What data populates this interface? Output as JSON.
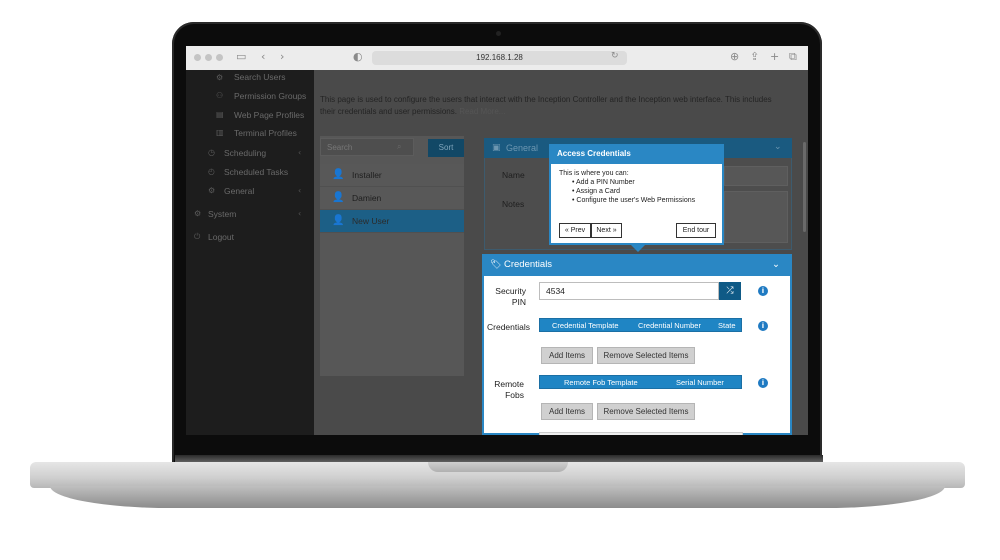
{
  "browser": {
    "url": "192.168.1.28"
  },
  "sidebar": {
    "items": [
      {
        "label": "Search Users",
        "icon": "gear-icon",
        "indent": true
      },
      {
        "label": "Permission Groups",
        "icon": "people-icon",
        "indent": true
      },
      {
        "label": "Web Page Profiles",
        "icon": "page-icon",
        "indent": true
      },
      {
        "label": "Terminal Profiles",
        "icon": "terminal-icon",
        "indent": true
      },
      {
        "label": "Scheduling",
        "icon": "calendar-icon",
        "indent": false,
        "has_arrow": true
      },
      {
        "label": "Scheduled Tasks",
        "icon": "clock-icon",
        "indent": false
      },
      {
        "label": "General",
        "icon": "settings-icon",
        "indent": false,
        "has_arrow": true
      },
      {
        "label": "System",
        "icon": "gear-icon",
        "indent": false,
        "has_arrow": true
      },
      {
        "label": "Logout",
        "icon": "logout-icon",
        "indent": false
      }
    ]
  },
  "intro": {
    "text": "This page is used to configure the users that interact with the Inception Controller and the Inception web interface. This includes their credentials and user permissions.",
    "read_more": "Read More..."
  },
  "users": {
    "search_placeholder": "Search",
    "sort_label": "Sort",
    "rows": [
      {
        "name": "Installer",
        "selected": false
      },
      {
        "name": "Damien",
        "selected": false
      },
      {
        "name": "New User",
        "selected": true
      }
    ]
  },
  "general_panel": {
    "title": "General",
    "fields": [
      "Name",
      "Notes"
    ]
  },
  "tour": {
    "title": "Access Credentials",
    "intro": "This is where you can:",
    "bullets": [
      "Add a PIN Number",
      "Assign a Card",
      "Configure the user's Web Permissions"
    ],
    "prev_label": "« Prev",
    "next_label": "Next »",
    "end_label": "End tour"
  },
  "credentials_panel": {
    "title": "Credentials",
    "security_pin_label_line1": "Security",
    "security_pin_label_line2": "PIN",
    "security_pin_value": "4534",
    "credentials_label": "Credentials",
    "credentials_columns": [
      "Credential Template",
      "Credential Number",
      "State"
    ],
    "remote_fobs_label_line1": "Remote",
    "remote_fobs_label_line2": "Fobs",
    "remote_fobs_columns": [
      "Remote Fob Template",
      "Serial Number"
    ],
    "add_items_label": "Add Items",
    "remove_selected_label": "Remove Selected Items"
  },
  "colors": {
    "accent": "#2a87c4",
    "accent_dark": "#0f5a86",
    "sidebar_bg": "#1d1d1d",
    "overlay_bg": "#4a4a4a"
  }
}
